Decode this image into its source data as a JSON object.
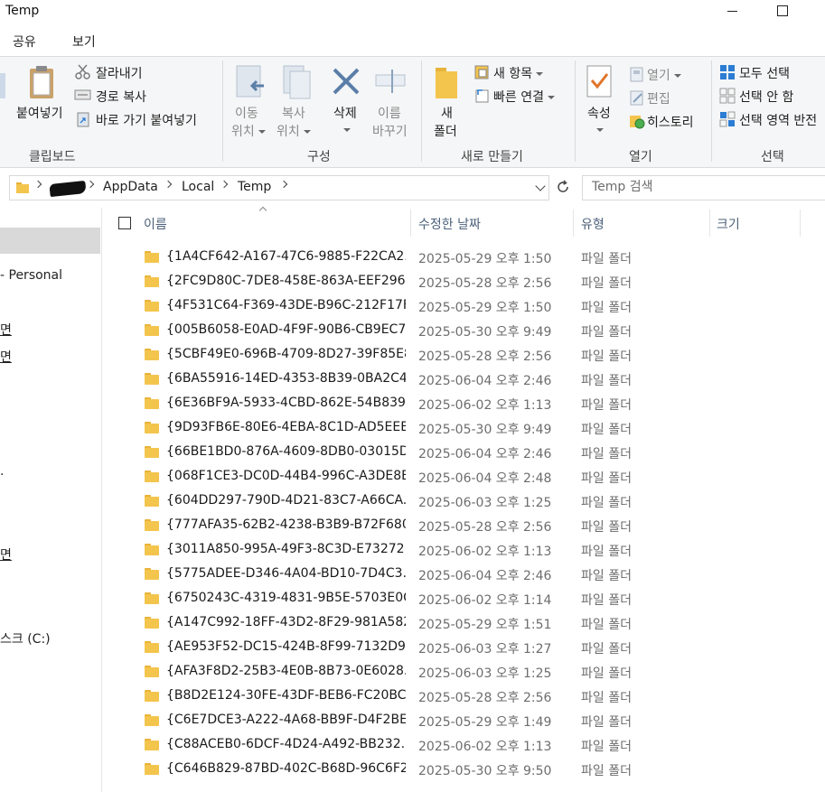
{
  "window": {
    "title": "Temp"
  },
  "ribbon_tabs": {
    "share": "공유",
    "view": "보기"
  },
  "clipboard": {
    "paste": "붙여넣기",
    "cut": "잘라내기",
    "copy_path": "경로 복사",
    "paste_shortcut": "바로 가기 붙여넣기",
    "group": "클립보드"
  },
  "organize": {
    "move_to_1": "이동",
    "move_to_2": "위치",
    "copy_to_1": "복사",
    "copy_to_2": "위치",
    "delete": "삭제",
    "rename_1": "이름",
    "rename_2": "바꾸기",
    "group": "구성"
  },
  "new_group": {
    "new_folder_1": "새",
    "new_folder_2": "폴더",
    "new_item": "새 항목",
    "easy_access": "빠른 연결",
    "group": "새로 만들기"
  },
  "open_group": {
    "properties": "속성",
    "open": "열기",
    "edit": "편집",
    "history": "히스토리",
    "group": "열기"
  },
  "select_group": {
    "select_all": "모두 선택",
    "select_none": "선택 안 함",
    "invert_selection": "선택 영역 반전",
    "group": "선택"
  },
  "address": {
    "crumbs": [
      "AppData",
      "Local",
      "Temp"
    ]
  },
  "search": {
    "placeholder": "Temp 검색"
  },
  "nav": {
    "personal": "- Personal",
    "item_a": "면",
    "item_b": "면",
    "item_c": ".",
    "item_d": "면",
    "drive": "스크 (C:)"
  },
  "columns": {
    "name": "이름",
    "date": "수정한 날짜",
    "type": "유형",
    "size": "크기"
  },
  "files": [
    {
      "name": "{1A4CF642-A167-47C6-9885-F22CA2...",
      "date": "2025-05-29 오후 1:50",
      "type": "파일 폴더"
    },
    {
      "name": "{2FC9D80C-7DE8-458E-863A-EEF296...",
      "date": "2025-05-28 오후 2:56",
      "type": "파일 폴더"
    },
    {
      "name": "{4F531C64-F369-43DE-B96C-212F17F...",
      "date": "2025-05-29 오후 1:50",
      "type": "파일 폴더"
    },
    {
      "name": "{005B6058-E0AD-4F9F-90B6-CB9EC7...",
      "date": "2025-05-30 오후 9:49",
      "type": "파일 폴더"
    },
    {
      "name": "{5CBF49E0-696B-4709-8D27-39F85E8...",
      "date": "2025-05-28 오후 2:56",
      "type": "파일 폴더"
    },
    {
      "name": "{6BA55916-14ED-4353-8B39-0BA2C4...",
      "date": "2025-06-04 오후 2:46",
      "type": "파일 폴더"
    },
    {
      "name": "{6E36BF9A-5933-4CBD-862E-54B839...",
      "date": "2025-06-02 오후 1:13",
      "type": "파일 폴더"
    },
    {
      "name": "{9D93FB6E-80E6-4EBA-8C1D-AD5EEB...",
      "date": "2025-05-30 오후 9:49",
      "type": "파일 폴더"
    },
    {
      "name": "{66BE1BD0-876A-4609-8DB0-03015D...",
      "date": "2025-06-04 오후 2:46",
      "type": "파일 폴더"
    },
    {
      "name": "{068F1CE3-DC0D-44B4-996C-A3DE8E...",
      "date": "2025-06-04 오후 2:48",
      "type": "파일 폴더"
    },
    {
      "name": "{604DD297-790D-4D21-83C7-A66CA...",
      "date": "2025-06-03 오후 1:25",
      "type": "파일 폴더"
    },
    {
      "name": "{777AFA35-62B2-4238-B3B9-B72F680...",
      "date": "2025-05-28 오후 2:56",
      "type": "파일 폴더"
    },
    {
      "name": "{3011A850-995A-49F3-8C3D-E73272...",
      "date": "2025-06-02 오후 1:13",
      "type": "파일 폴더"
    },
    {
      "name": "{5775ADEE-D346-4A04-BD10-7D4C3...",
      "date": "2025-06-04 오후 2:46",
      "type": "파일 폴더"
    },
    {
      "name": "{6750243C-4319-4831-9B5E-5703E0C...",
      "date": "2025-06-02 오후 1:14",
      "type": "파일 폴더"
    },
    {
      "name": "{A147C992-18FF-43D2-8F29-981A582...",
      "date": "2025-05-29 오후 1:51",
      "type": "파일 폴더"
    },
    {
      "name": "{AE953F52-DC15-424B-8F99-7132D98...",
      "date": "2025-06-03 오후 1:27",
      "type": "파일 폴더"
    },
    {
      "name": "{AFA3F8D2-25B3-4E0B-8B73-0E6028...",
      "date": "2025-06-03 오후 1:25",
      "type": "파일 폴더"
    },
    {
      "name": "{B8D2E124-30FE-43DF-BEB6-FC20BC...",
      "date": "2025-05-28 오후 2:56",
      "type": "파일 폴더"
    },
    {
      "name": "{C6E7DCE3-A222-4A68-BB9F-D4F2BE...",
      "date": "2025-05-29 오후 1:49",
      "type": "파일 폴더"
    },
    {
      "name": "{C88ACEB0-6DCF-4D24-A492-BB232...",
      "date": "2025-06-02 오후 1:13",
      "type": "파일 폴더"
    },
    {
      "name": "{C646B829-87BD-402C-B68D-96C6F2...",
      "date": "2025-05-30 오후 9:50",
      "type": "파일 폴더"
    }
  ],
  "icons": {
    "paste": "clipboard-icon",
    "cut": "scissors-icon",
    "copy_path": "copy-path-icon",
    "paste_shortcut": "paste-shortcut-icon",
    "move_to": "move-to-icon",
    "copy_to": "copy-to-icon",
    "delete": "delete-x-icon",
    "rename": "rename-icon",
    "new_folder": "folder-icon",
    "new_item": "new-item-icon",
    "easy_access": "easy-access-icon",
    "properties": "properties-check-icon",
    "open": "open-icon",
    "edit": "edit-icon",
    "history": "history-icon",
    "select_all": "select-all-icon",
    "select_none": "select-none-icon",
    "invert": "invert-selection-icon"
  },
  "colors": {
    "folder": "#f4c54d",
    "accent": "#2b7cd3",
    "delete": "#5b7ea8",
    "ribbon_bg": "#f5f6f7"
  }
}
